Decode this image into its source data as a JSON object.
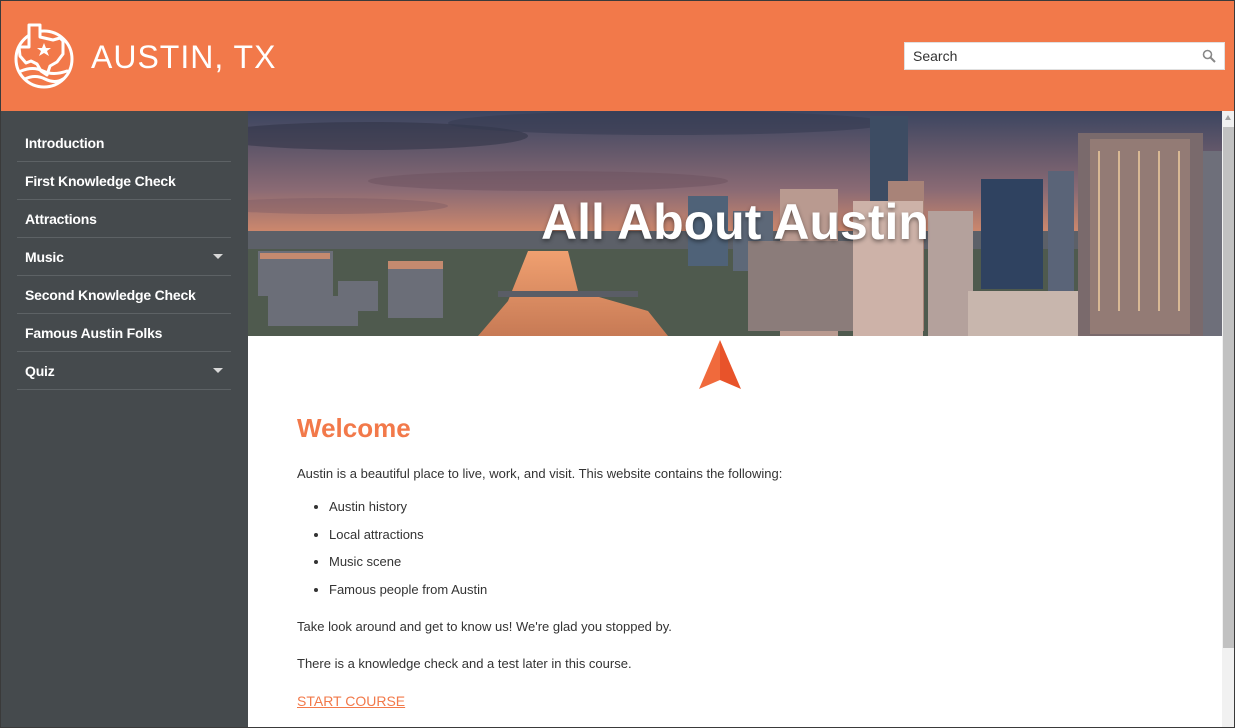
{
  "header": {
    "brand": "AUSTIN, TX",
    "search_placeholder": "Search",
    "accent_color": "#f2794a",
    "logo_icon": "texas-star-logo-icon",
    "search_icon": "magnifier-icon"
  },
  "sidebar": {
    "items": [
      {
        "label": "Introduction",
        "has_submenu": false
      },
      {
        "label": "First Knowledge Check",
        "has_submenu": false
      },
      {
        "label": "Attractions",
        "has_submenu": false
      },
      {
        "label": "Music",
        "has_submenu": true
      },
      {
        "label": "Second Knowledge Check",
        "has_submenu": false
      },
      {
        "label": "Famous Austin Folks",
        "has_submenu": false
      },
      {
        "label": "Quiz",
        "has_submenu": true
      }
    ]
  },
  "hero": {
    "title": "All About Austin"
  },
  "content": {
    "heading": "Welcome",
    "intro": "Austin is a beautiful place to live, work, and visit. This website contains the following:",
    "bullets": [
      "Austin history",
      "Local attractions",
      "Music scene",
      "Famous people from Austin"
    ],
    "para2": "Take look around and get to know us! We're glad you stopped by.",
    "para3": "There is a knowledge check and a test later in this course.",
    "start_link": "START COURSE"
  }
}
